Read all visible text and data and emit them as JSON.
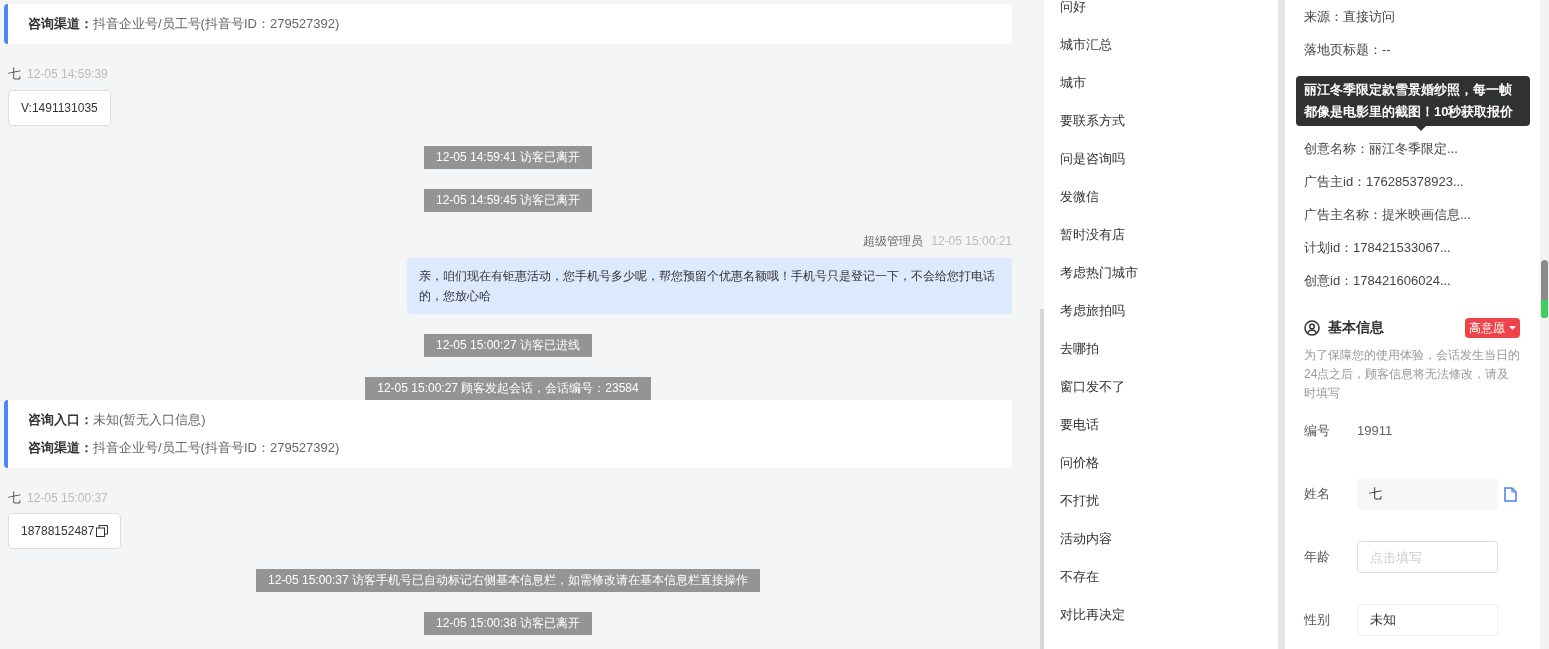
{
  "chat": {
    "messages": [
      {
        "kind": "info_card",
        "lines": [
          {
            "label": "咨询渠道：",
            "value": "抖音企业号/员工号(抖音号ID：279527392)"
          }
        ]
      },
      {
        "kind": "visitor",
        "sender": "七",
        "time": "12-05 14:59:39",
        "text": "V:1491131035",
        "copy": false
      },
      {
        "kind": "system",
        "text": "12-05 14:59:41 访客已离开"
      },
      {
        "kind": "system",
        "text": "12-05 14:59:45 访客已离开"
      },
      {
        "kind": "agent",
        "sender": "超级管理员",
        "time": "12-05 15:00:21",
        "text": "亲，咱们现在有钜惠活动，您手机号多少呢，帮您预留个优惠名额哦！手机号只是登记一下，不会给您打电话的，您放心哈"
      },
      {
        "kind": "system",
        "text": "12-05 15:00:27 访客已进线"
      },
      {
        "kind": "system",
        "text": "12-05 15:00:27 顾客发起会话，会话编号：23584"
      },
      {
        "kind": "info_card",
        "lines": [
          {
            "label": "咨询入口：",
            "value": "未知(暂无入口信息)"
          },
          {
            "label": "咨询渠道：",
            "value": "抖音企业号/员工号(抖音号ID：279527392)"
          }
        ]
      },
      {
        "kind": "visitor",
        "sender": "七",
        "time": "12-05 15:00:37",
        "text": "18788152487",
        "copy": true
      },
      {
        "kind": "system",
        "text": "12-05 15:00:37 访客手机号已自动标记右侧基本信息栏，如需修改请在基本信息栏直接操作"
      },
      {
        "kind": "system",
        "text": "12-05 15:00:38 访客已离开"
      }
    ]
  },
  "quick_replies": [
    "问好",
    "城市汇总",
    "城市",
    "要联系方式",
    "问是咨询吗",
    "发微信",
    "暂时没有店",
    "考虑热门城市",
    "考虑旅拍吗",
    "去哪拍",
    "窗口发不了",
    "要电话",
    "问价格",
    "不打扰",
    "活动内容",
    "不存在",
    "对比再决定"
  ],
  "source_info": {
    "rows": [
      "来源：直接访问",
      "落地页标题：--",
      "创意名称：丽江冬季限定...",
      "广告主id：176285378923...",
      "广告主名称：提米映画信息...",
      "计划id：178421533067...",
      "创意id：178421606024..."
    ],
    "tooltip": "丽江冬季限定款雪景婚纱照，每一帧都像是电影里的截图！10秒获取报价"
  },
  "basic_info": {
    "title": "基本信息",
    "intent_tag": "高意愿",
    "notice": "为了保障您的使用体验，会话发生当日的24点之后，顾客信息将无法修改，请及时填写",
    "fields": [
      {
        "kind": "text",
        "label": "编号",
        "value": "19911"
      },
      {
        "kind": "readonly",
        "label": "姓名",
        "value": "七"
      },
      {
        "kind": "input",
        "label": "年龄",
        "placeholder": "点击填写"
      },
      {
        "kind": "select",
        "label": "性别",
        "value": "未知"
      }
    ]
  }
}
